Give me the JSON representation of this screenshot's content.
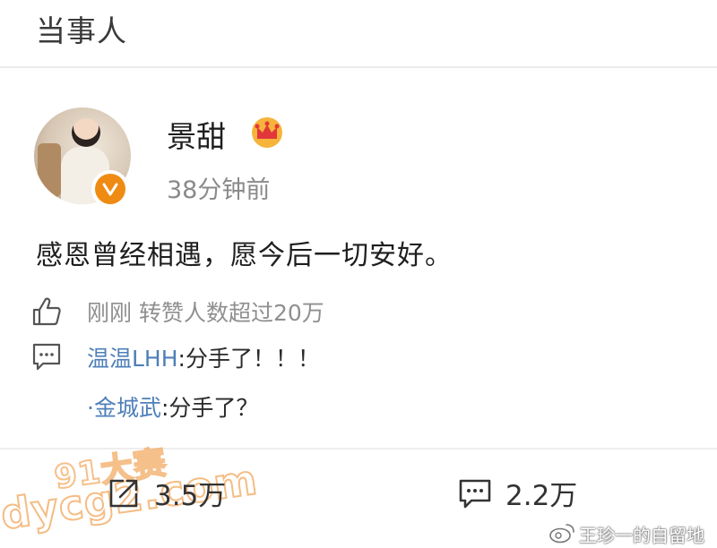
{
  "header": {
    "title": "当事人"
  },
  "post": {
    "user_name": "景甜",
    "time": "38分钟前",
    "text": "感恩曾经相遇，愿今后一切安好。",
    "like_summary": "刚刚 转赞人数超过20万",
    "badge_icon": "verified-v-icon",
    "member_icon": "crown-icon"
  },
  "comments": [
    {
      "user": "温温LHH",
      "text": ":分手了！！！"
    },
    {
      "user": "·金城武",
      "text": ":分手了？"
    }
  ],
  "actions": {
    "repost_count": "3.5万",
    "comment_count": "2.2万"
  },
  "watermarks": {
    "line1": "91大赛",
    "line2": "dycg2.com",
    "source": "王珍一的自留地"
  },
  "colors": {
    "username_blue": "#4e7fb8",
    "badge_orange": "#ef8b12",
    "watermark_orange": "#f1a65a"
  }
}
